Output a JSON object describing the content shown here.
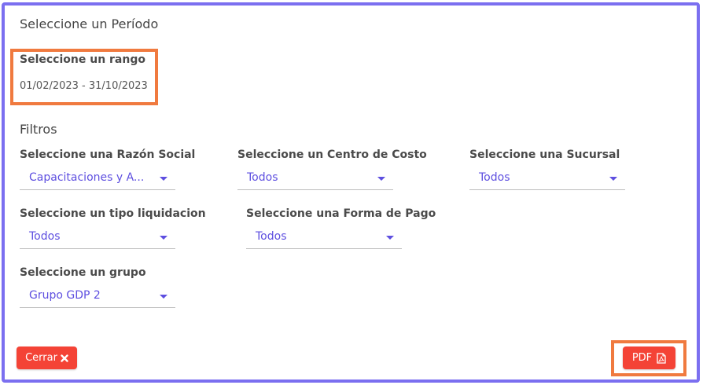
{
  "period": {
    "title": "Seleccione un Período",
    "range_label": "Seleccione un rango",
    "range_value": "01/02/2023 - 31/10/2023"
  },
  "filters": {
    "title": "Filtros",
    "razon_social": {
      "label": "Seleccione una Razón Social",
      "value": "Capacitaciones y A..."
    },
    "centro_costo": {
      "label": "Seleccione un Centro de Costo",
      "value": "Todos"
    },
    "sucursal": {
      "label": "Seleccione una Sucursal",
      "value": "Todos"
    },
    "tipo_liquidacion": {
      "label": "Seleccione un tipo liquidacion",
      "value": "Todos"
    },
    "forma_pago": {
      "label": "Seleccione una Forma de Pago",
      "value": "Todos"
    },
    "grupo": {
      "label": "Seleccione un grupo",
      "value": "Grupo GDP 2"
    }
  },
  "buttons": {
    "cerrar": "Cerrar",
    "pdf": "PDF"
  },
  "colors": {
    "accent": "#5e4fe0",
    "frame": "#7b6ff0",
    "highlight": "#f07a3f",
    "button": "#f44336"
  },
  "icons": {
    "cerrar": "close-icon",
    "pdf": "pdf-file-icon",
    "dropdown": "caret-down-icon"
  }
}
